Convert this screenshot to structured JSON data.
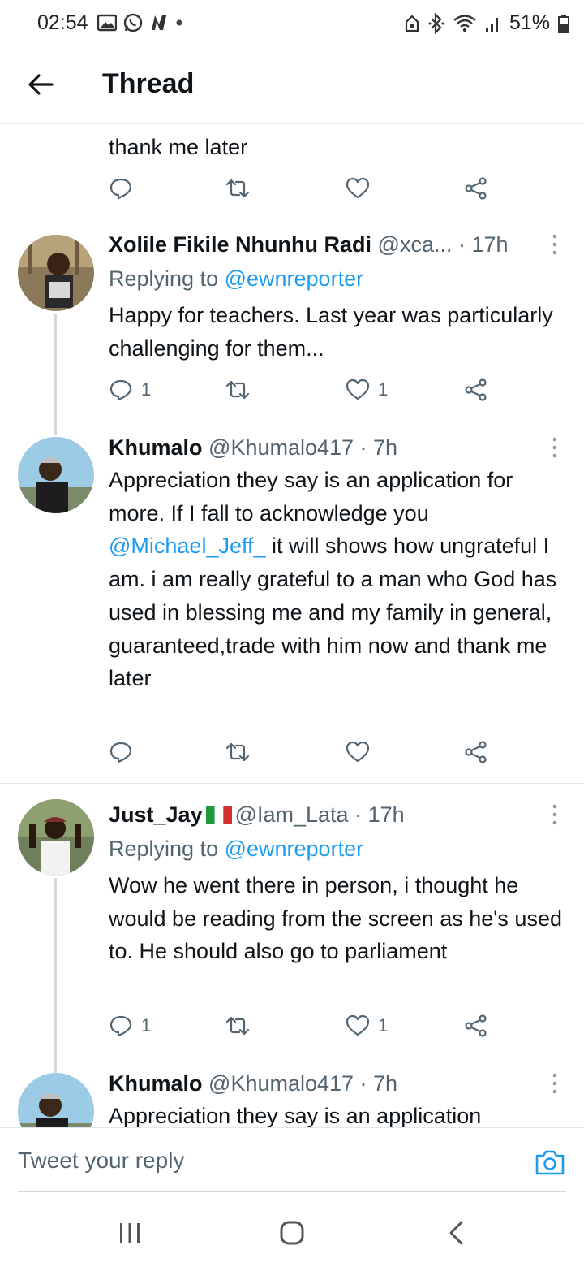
{
  "status_bar": {
    "time": "02:54",
    "battery": "51%",
    "icons_left": [
      "gallery-icon",
      "whatsapp-icon",
      "n-app-icon",
      "dot-icon"
    ],
    "icons_right": [
      "lock-icon",
      "bluetooth-icon",
      "wifi-icon",
      "signal-icon",
      "battery-icon"
    ]
  },
  "header": {
    "title": "Thread",
    "back_icon": "arrow-left-icon"
  },
  "partial_tweet": {
    "text_tail": "thank me later"
  },
  "tweets": [
    {
      "name": "Xolile Fikile Nhunhu Radi",
      "handle_time": "@xca... · 17h",
      "replying_prefix": "Replying to ",
      "replying_to": "@ewnreporter",
      "body": "Happy for teachers. Last year was particularly challenging for them...",
      "reply_count": "1",
      "like_count": "1"
    },
    {
      "name": "Khumalo",
      "handle_time": "@Khumalo417 · 7h",
      "body_part1": "Appreciation they say is an application for more. If I fall to acknowledge you ",
      "mention": "@Michael_Jeff_",
      "body_part2": " it will shows how ungrateful I am. i am really grateful to a man who God has used in blessing me and my family in general, guaranteed,trade with him now and thank me later"
    },
    {
      "name": "Just_Jay",
      "flag": "italy-flag",
      "handle_time": "@Iam_Lata · 17h",
      "replying_prefix": "Replying to ",
      "replying_to": "@ewnreporter",
      "body": "Wow he went there in person, i thought he would be reading from the screen as he's used to. He should also go to parliament",
      "reply_count": "1",
      "like_count": "1"
    },
    {
      "name": "Khumalo",
      "handle_time": "@Khumalo417 · 7h",
      "body": "Appreciation they say is an application"
    }
  ],
  "reply_bar": {
    "placeholder": "Tweet your reply",
    "camera_icon": "camera-icon"
  },
  "nav_bar": {
    "buttons": [
      "recent-apps-icon",
      "home-icon",
      "back-icon"
    ]
  },
  "colors": {
    "accent": "#1d9bf0",
    "secondary_text": "#536471"
  }
}
